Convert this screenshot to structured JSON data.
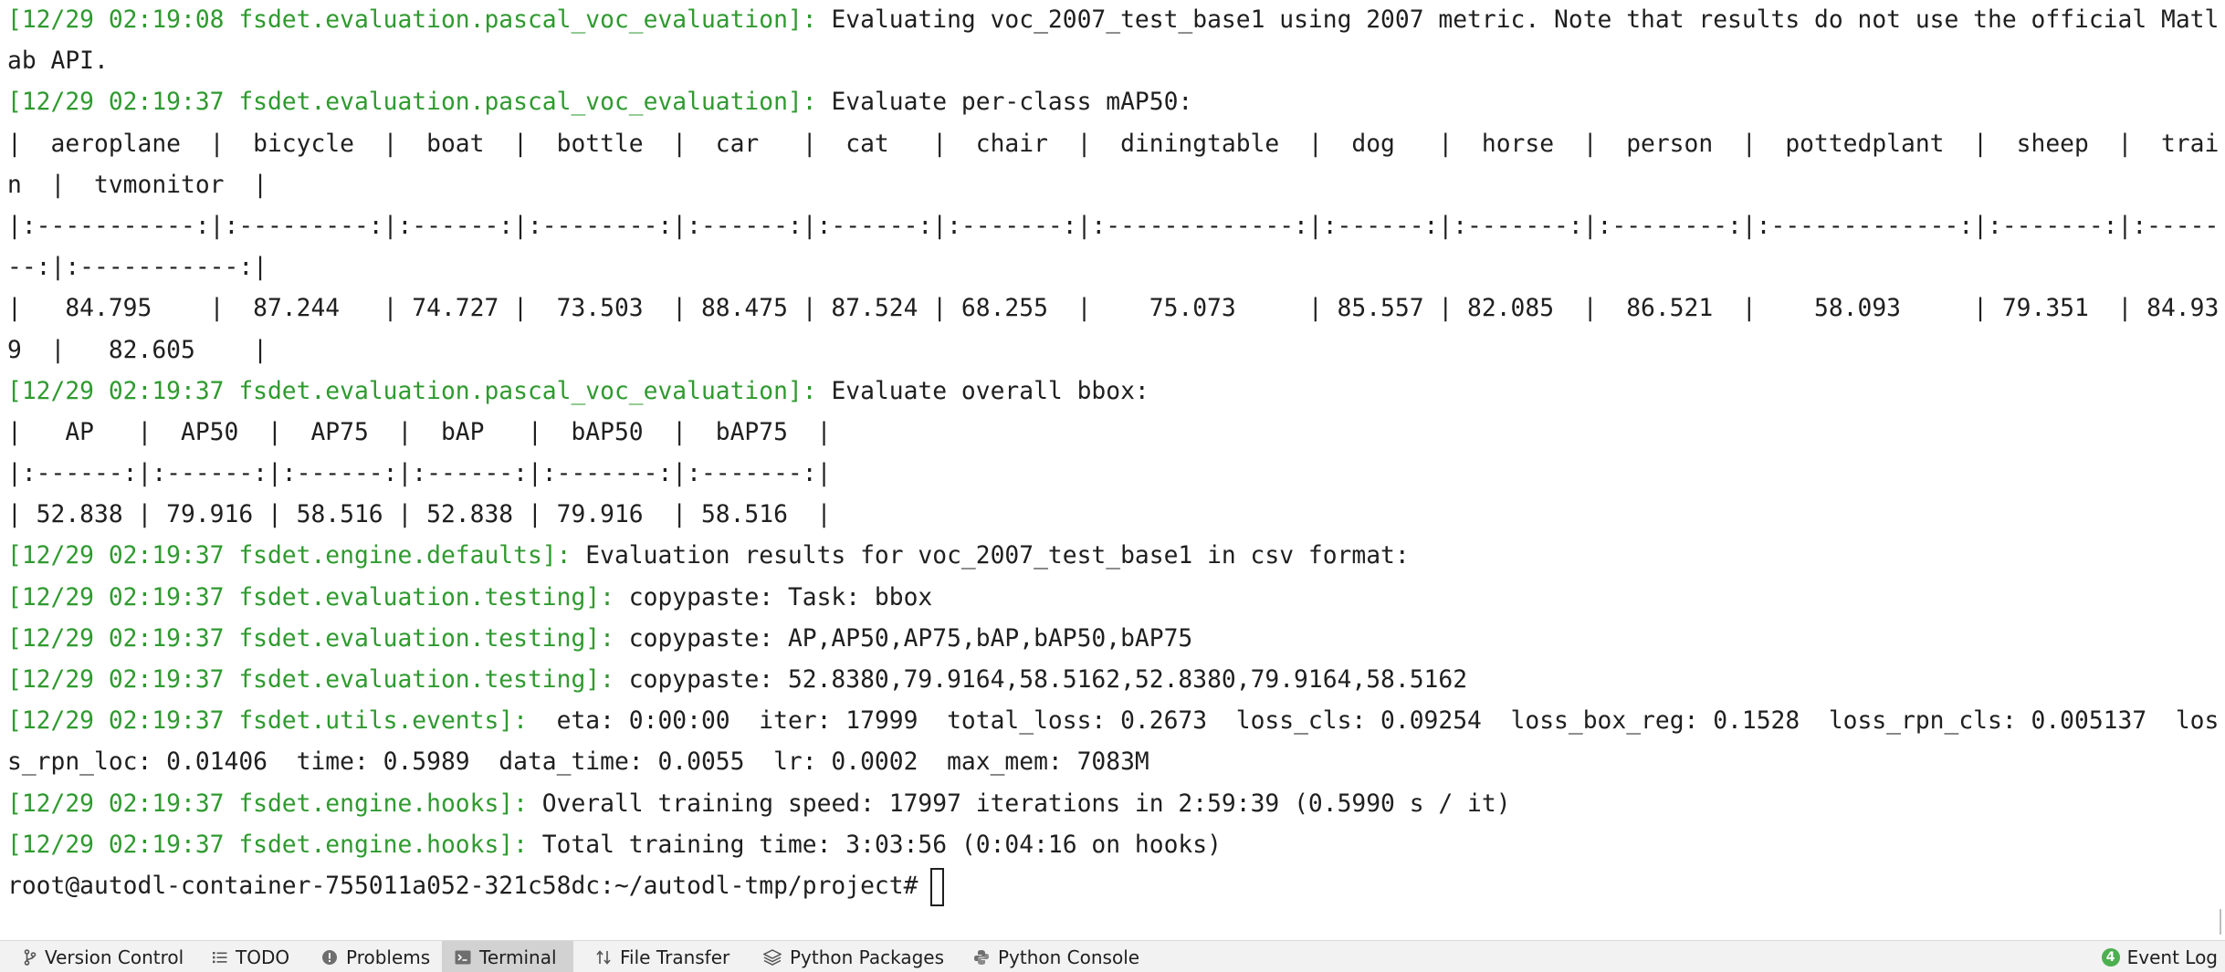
{
  "terminal": {
    "lines": [
      {
        "prefix": "[12/29 02:19:08 fsdet.evaluation.pascal_voc_evaluation]:",
        "text": " Evaluating voc_2007_test_base1 using 2007 metric. Note that results do not use the official Matl"
      },
      {
        "prefix": "",
        "text": "ab API."
      },
      {
        "prefix": "[12/29 02:19:37 fsdet.evaluation.pascal_voc_evaluation]:",
        "text": " Evaluate per-class mAP50:"
      },
      {
        "prefix": "",
        "text": "|  aeroplane  |  bicycle  |  boat  |  bottle  |  car   |  cat   |  chair  |  diningtable  |  dog   |  horse  |  person  |  pottedplant  |  sheep  |  trai"
      },
      {
        "prefix": "",
        "text": "n  |  tvmonitor  |"
      },
      {
        "prefix": "",
        "text": "|:-----------:|:---------:|:------:|:--------:|:------:|:------:|:-------:|:-------------:|:------:|:-------:|:--------:|:-------------:|:-------:|:-----"
      },
      {
        "prefix": "",
        "text": "--:|:-----------:|"
      },
      {
        "prefix": "",
        "text": "|   84.795    |  87.244   | 74.727 |  73.503  | 88.475 | 87.524 | 68.255  |    75.073     | 85.557 | 82.085  |  86.521  |    58.093     | 79.351  | 84.93"
      },
      {
        "prefix": "",
        "text": "9  |   82.605    |"
      },
      {
        "prefix": "[12/29 02:19:37 fsdet.evaluation.pascal_voc_evaluation]:",
        "text": " Evaluate overall bbox:"
      },
      {
        "prefix": "",
        "text": "|   AP   |  AP50  |  AP75  |  bAP   |  bAP50  |  bAP75  |"
      },
      {
        "prefix": "",
        "text": "|:------:|:------:|:------:|:------:|:-------:|:-------:|"
      },
      {
        "prefix": "",
        "text": "| 52.838 | 79.916 | 58.516 | 52.838 | 79.916  | 58.516  |"
      },
      {
        "prefix": "[12/29 02:19:37 fsdet.engine.defaults]:",
        "text": " Evaluation results for voc_2007_test_base1 in csv format:"
      },
      {
        "prefix": "[12/29 02:19:37 fsdet.evaluation.testing]:",
        "text": " copypaste: Task: bbox"
      },
      {
        "prefix": "[12/29 02:19:37 fsdet.evaluation.testing]:",
        "text": " copypaste: AP,AP50,AP75,bAP,bAP50,bAP75"
      },
      {
        "prefix": "[12/29 02:19:37 fsdet.evaluation.testing]:",
        "text": " copypaste: 52.8380,79.9164,58.5162,52.8380,79.9164,58.5162"
      },
      {
        "prefix": "[12/29 02:19:37 fsdet.utils.events]:",
        "text": "  eta: 0:00:00  iter: 17999  total_loss: 0.2673  loss_cls: 0.09254  loss_box_reg: 0.1528  loss_rpn_cls: 0.005137  los"
      },
      {
        "prefix": "",
        "text": "s_rpn_loc: 0.01406  time: 0.5989  data_time: 0.0055  lr: 0.0002  max_mem: 7083M"
      },
      {
        "prefix": "[12/29 02:19:37 fsdet.engine.hooks]:",
        "text": " Overall training speed: 17997 iterations in 2:59:39 (0.5990 s / it)"
      },
      {
        "prefix": "[12/29 02:19:37 fsdet.engine.hooks]:",
        "text": " Total training time: 3:03:56 (0:04:16 on hooks)"
      }
    ],
    "prompt": "root@autodl-container-755011a052-321c58dc:~/autodl-tmp/project#"
  },
  "statusbar": {
    "tabs": [
      {
        "label": "Version Control",
        "icon": "branch-icon"
      },
      {
        "label": "TODO",
        "icon": "list-icon"
      },
      {
        "label": "Problems",
        "icon": "alert-icon"
      },
      {
        "label": "Terminal",
        "icon": "terminal-icon",
        "active": true
      },
      {
        "label": "File Transfer",
        "icon": "transfer-icon"
      },
      {
        "label": "Python Packages",
        "icon": "layers-icon"
      },
      {
        "label": "Python Console",
        "icon": "python-icon"
      }
    ],
    "event_log": {
      "label": "Event Log",
      "count": "4"
    }
  },
  "colors": {
    "log_prefix": "#2f9a2f",
    "text": "#1f1f1f",
    "active_tab": "#d2d2d2",
    "statusbar_bg": "#f2f2f2",
    "badge": "#4caf50"
  }
}
